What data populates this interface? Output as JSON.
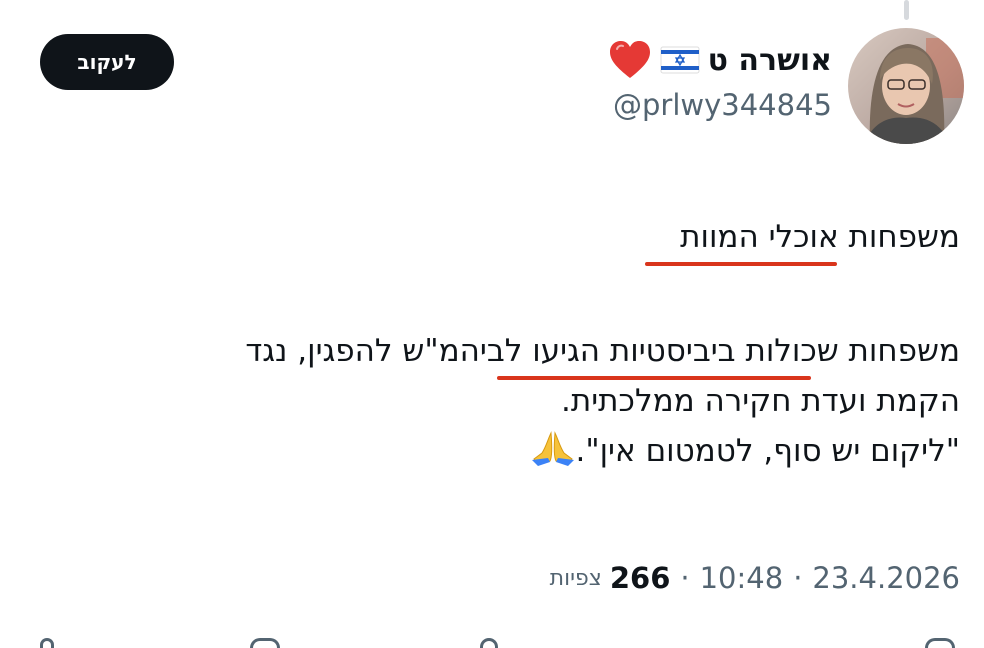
{
  "header": {
    "display_name": "אושרה ט",
    "handle": "@prlwy344845",
    "follow_label": "לעקוב"
  },
  "icons": {
    "flag": "israel-flag-icon",
    "heart": "red-heart-icon",
    "pray": "folded-hands-icon"
  },
  "colors": {
    "underline": "#d9351c",
    "follow_bg": "#0f1419",
    "meta_text": "#536471"
  },
  "tweet": {
    "line1": "משפחות אוכלי המוות",
    "paragraph": [
      "משפחות שכולות ביביסטיות הגיעו לביהמ\"ש להפגין, נגד",
      "הקמת ועדת חקירה ממלכתית.",
      "\"ליקום יש סוף, לטמטום אין\"."
    ]
  },
  "meta": {
    "date": "23.4.2026",
    "time": "10:48",
    "views_count": "266",
    "views_label": "צפיות"
  }
}
